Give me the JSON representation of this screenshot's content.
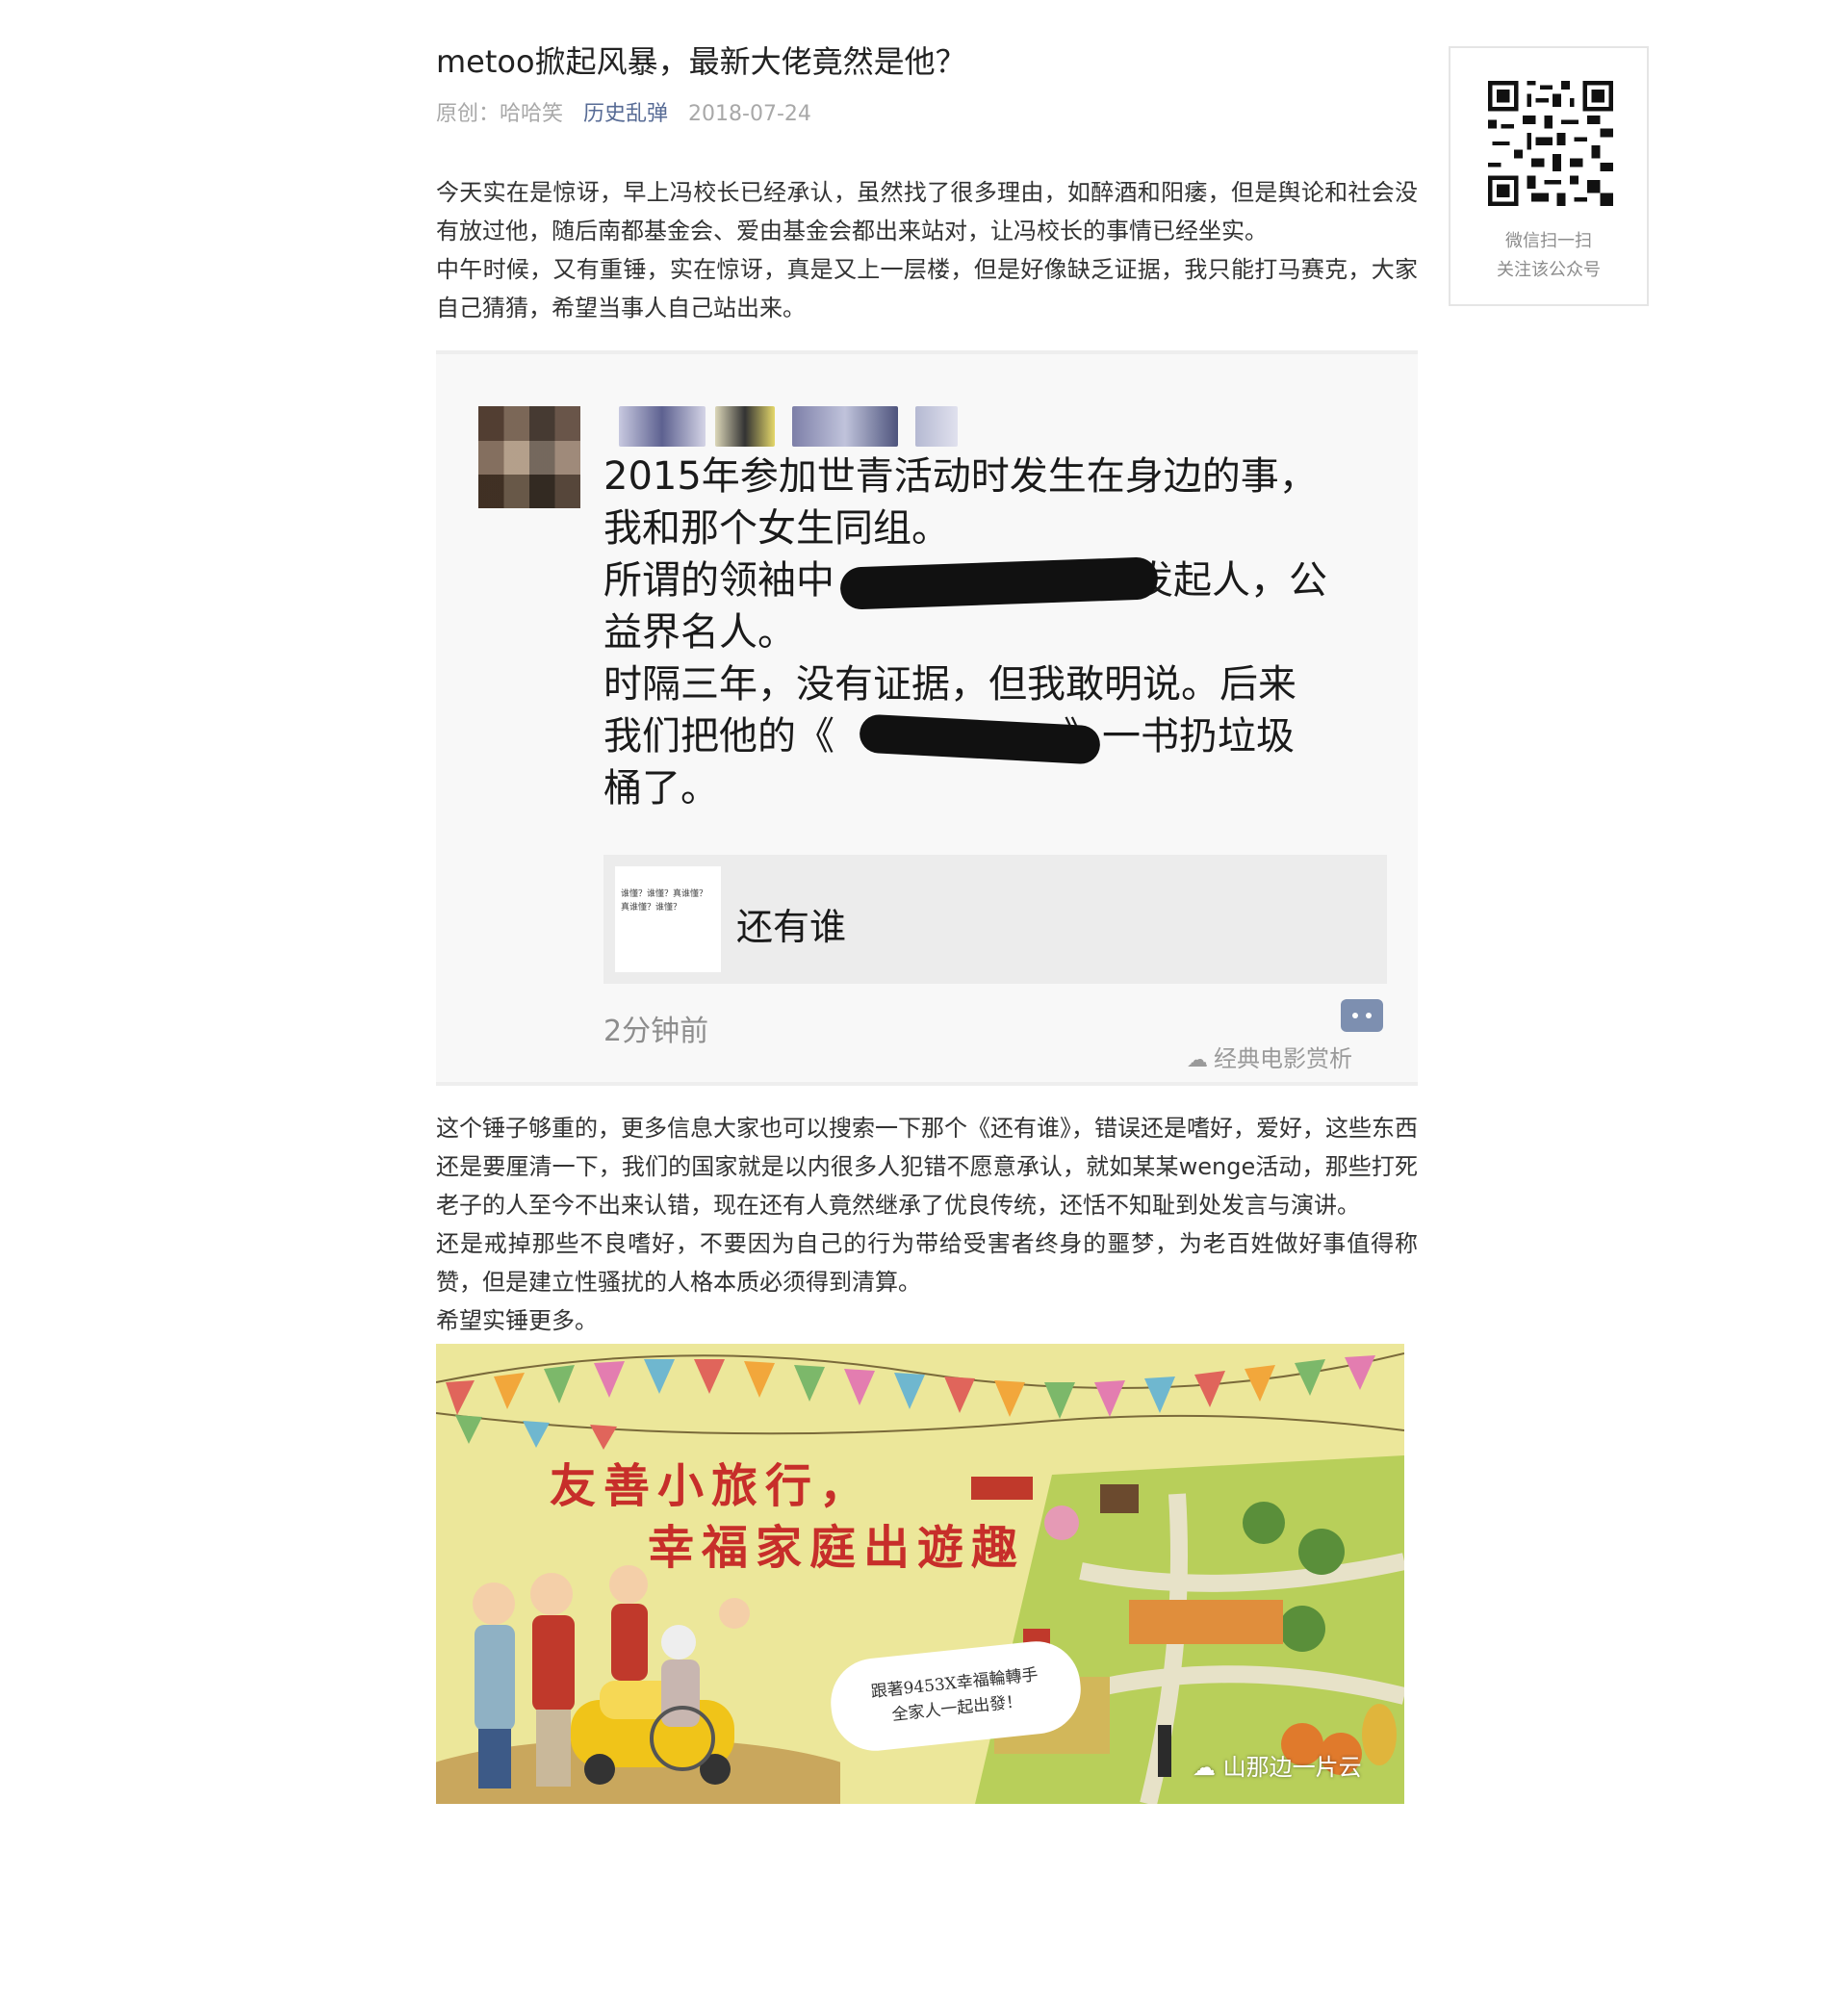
{
  "article": {
    "title": "metoo掀起风暴，最新大佬竟然是他？",
    "meta": {
      "original_label": "原创：",
      "author": "哈哈笑",
      "account": "历史乱弹",
      "date": "2018-07-24"
    },
    "paragraphs_top": [
      "今天实在是惊讶，早上冯校长已经承认，虽然找了很多理由，如醉酒和阳痿，但是舆论和社会没有放过他，随后南都基金会、爱由基金会都出来站对，让冯校长的事情已经坐实。",
      "中午时候，又有重锤，实在惊讶，真是又上一层楼，但是好像缺乏证据，我只能打马赛克，大家自己猜猜，希望当事人自己站出来。"
    ],
    "screenshot": {
      "lines": [
        "2015年参加世青活动时发生在身边的事，",
        "我和那个女生同组。",
        "所谓的领袖中",
        "发起人，公",
        "益界名人。",
        "时隔三年，没有证据，但我敢明说。后来",
        "我们把他的《",
        "》一书扔垃圾",
        "桶了。"
      ],
      "link_title": "还有谁",
      "link_thumb_text": "谁懂？谁懂？真谁懂？真谁懂？谁懂？",
      "timestamp": "2分钟前",
      "watermark": "经典电影赏析"
    },
    "paragraphs_bottom": [
      "这个锤子够重的，更多信息大家也可以搜索一下那个《还有谁》，错误还是嗜好，爱好，这些东西还是要厘清一下，我们的国家就是以内很多人犯错不愿意承认，就如某某wenge活动，那些打死老子的人至今不出来认错，现在还有人竟然继承了优良传统，还恬不知耻到处发言与演讲。",
      "还是戒掉那些不良嗜好，不要因为自己的行为带给受害者终身的噩梦，为老百姓做好事值得称赞，但是建立性骚扰的人格本质必须得到清算。",
      "希望实锤更多。"
    ],
    "banner": {
      "title_line1": "友善小旅行，",
      "title_line2": "幸福家庭出遊趣",
      "bubble_line1": "跟著9453X幸福輪轉手",
      "bubble_line2": "全家人一起出發！",
      "watermark": "山那边一片云"
    }
  },
  "qr_panel": {
    "line1": "微信扫一扫",
    "line2": "关注该公众号"
  },
  "colors": {
    "account_link": "#576b95",
    "meta_gray": "#a8a8a8",
    "banner_bg": "#ece79a",
    "banner_title": "#c72e2a"
  }
}
